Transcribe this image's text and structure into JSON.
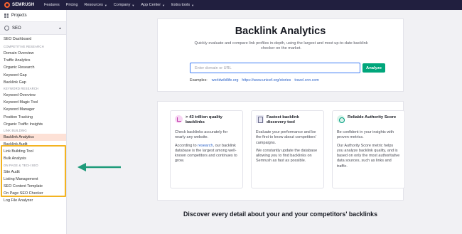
{
  "topbar": {
    "logo_text": "SEMRUSH",
    "nav": [
      {
        "label": "Features",
        "dropdown": false
      },
      {
        "label": "Pricing",
        "dropdown": false
      },
      {
        "label": "Resources",
        "dropdown": true
      },
      {
        "label": "Company",
        "dropdown": true
      },
      {
        "label": "App Center",
        "dropdown": true
      },
      {
        "label": "Extra tools",
        "dropdown": true
      }
    ]
  },
  "sidebar": {
    "projects": "Projects",
    "seo": "SEO",
    "dashboard": "SEO Dashboard",
    "sections": [
      {
        "title": "COMPETITIVE RESEARCH",
        "items": [
          "Domain Overview",
          "Traffic Analytics",
          "Organic Research",
          "Keyword Gap",
          "Backlink Gap"
        ]
      },
      {
        "title": "KEYWORD RESEARCH",
        "items": [
          "Keyword Overview",
          "Keyword Magic Tool",
          "Keyword Manager",
          "Position Tracking",
          "Organic Traffic Insights"
        ]
      },
      {
        "title": "LINK BUILDING",
        "items": [
          "Backlink Analytics",
          "Backlink Audit",
          "Link Building Tool",
          "Bulk Analysis"
        ]
      },
      {
        "title": "ON PAGE & TECH SEO",
        "items": [
          "Site Audit",
          "Listing Management",
          "SEO Content Template",
          "On Page SEO Checker",
          "Log File Analyzer"
        ]
      }
    ],
    "active_item": "Backlink Analytics"
  },
  "hero": {
    "title": "Backlink Analytics",
    "subtitle": "Quickly evaluate and compare link profiles in-depth, using the largest and most up-to-date backlink checker on the market.",
    "search_placeholder": "Enter domain or URL",
    "analyze_label": "Analyze",
    "examples_label": "Examples:",
    "examples": [
      "worldwildlife.org",
      "https://www.unicef.org/stories",
      "travel.cnn.com"
    ]
  },
  "features": [
    {
      "icon": "chart-icon",
      "title": "> 43 trillion quality backlinks",
      "paragraphs": [
        {
          "pre": "Check backlinks accurately for nearly any website.",
          "link": "",
          "post": ""
        },
        {
          "pre": "According to ",
          "link": "research",
          "post": ", our backlink database is the largest among well-known competitors and continues to grow."
        }
      ]
    },
    {
      "icon": "document-icon",
      "title": "Fastest backlink discovery tool",
      "paragraphs": [
        {
          "pre": "Evaluate your performance and be the first to know about competitors' campaigns.",
          "link": "",
          "post": ""
        },
        {
          "pre": "We constantly update the database allowing you to find backlinks on Semrush as fast as possible.",
          "link": "",
          "post": ""
        }
      ]
    },
    {
      "icon": "score-icon",
      "title": "Reliable Authority Score",
      "paragraphs": [
        {
          "pre": "Be confident in your insights with proven metrics.",
          "link": "",
          "post": ""
        },
        {
          "pre": "Our Authority Score metric helps you analyze backlink quality, and is based on only the most authoritative data sources, such as links and traffic.",
          "link": "",
          "post": ""
        }
      ]
    }
  ],
  "discover": "Discover every detail about your and your competitors' backlinks",
  "colors": {
    "highlight": "#f3b320",
    "arrow": "#1f9b7a",
    "analyze": "#00a67b",
    "topbar": "#211f3f",
    "active_bg": "#fde1d6"
  }
}
